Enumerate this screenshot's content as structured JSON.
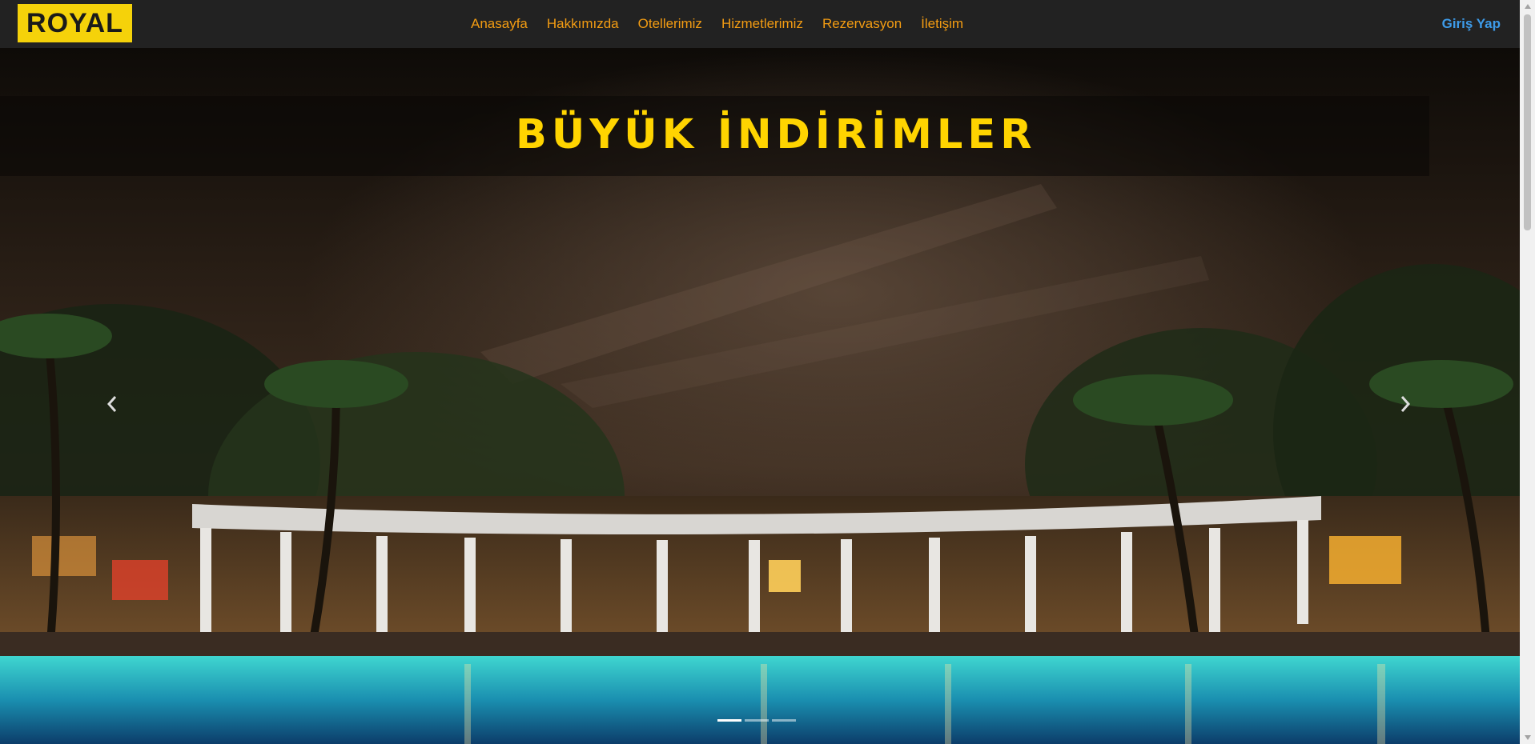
{
  "brand": {
    "label": "ROYAL",
    "color": "#f5d20a"
  },
  "nav": {
    "items": [
      {
        "label": "Anasayfa"
      },
      {
        "label": "Hakkımızda"
      },
      {
        "label": "Otellerimiz"
      },
      {
        "label": "Hizmetlerimiz"
      },
      {
        "label": "Rezervasyon"
      },
      {
        "label": "İletişim"
      }
    ],
    "link_color": "#f39c12",
    "login_label": "Giriş Yap",
    "login_color": "#3d9be9"
  },
  "carousel": {
    "caption": "BÜYÜK İNDİRİMLER",
    "caption_color": "#ffd400",
    "prev_icon": "chevron-left-icon",
    "next_icon": "chevron-right-icon",
    "slide_count": 3,
    "active_index": 0
  }
}
